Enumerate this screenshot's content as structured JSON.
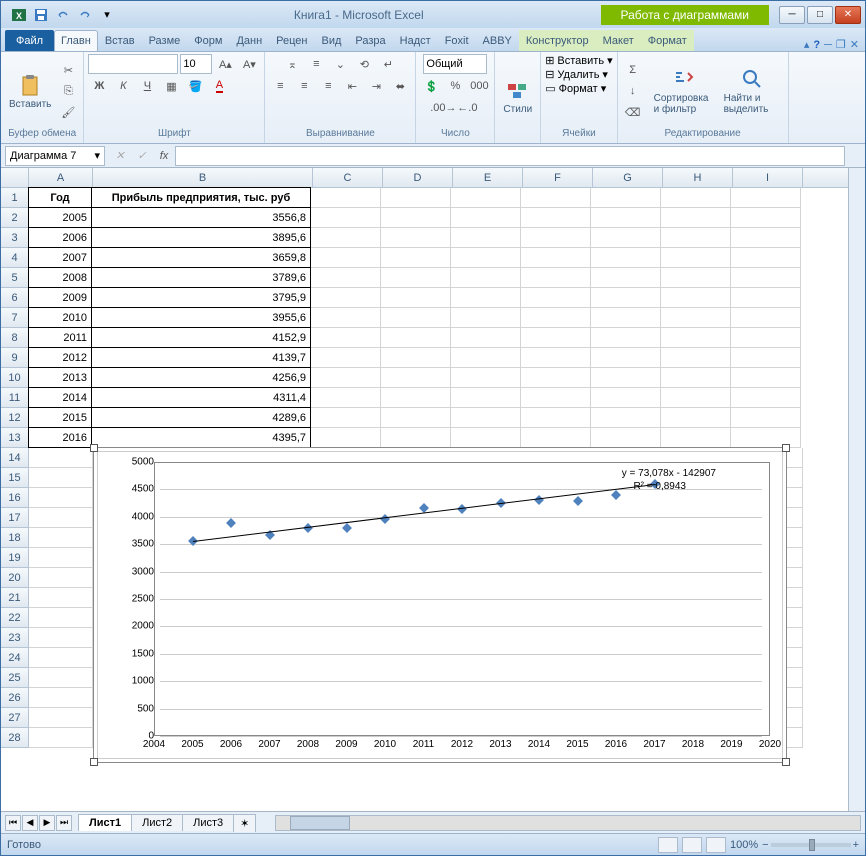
{
  "window": {
    "title": "Книга1 - Microsoft Excel",
    "chart_tools_title": "Работа с диаграммами"
  },
  "ribbon": {
    "file": "Файл",
    "tabs": [
      "Главн",
      "Встав",
      "Разме",
      "Форм",
      "Данн",
      "Рецен",
      "Вид",
      "Разра",
      "Надст",
      "Foxit",
      "ABBY"
    ],
    "chart_tabs": [
      "Конструктор",
      "Макет",
      "Формат"
    ],
    "groups": {
      "clipboard": {
        "paste": "Вставить",
        "label": "Буфер обмена"
      },
      "font": {
        "font_name": "",
        "font_size": "10",
        "label": "Шрифт"
      },
      "align": {
        "label": "Выравнивание"
      },
      "number": {
        "format": "Общий",
        "label": "Число"
      },
      "styles": {
        "btn": "Стили",
        "label": ""
      },
      "cells": {
        "insert": "Вставить",
        "delete": "Удалить",
        "format": "Формат",
        "label": "Ячейки"
      },
      "editing": {
        "sort": "Сортировка и фильтр",
        "find": "Найти и выделить",
        "label": "Редактирование"
      }
    }
  },
  "name_box": "Диаграмма 7",
  "formula": "",
  "columns": [
    "A",
    "B",
    "C",
    "D",
    "E",
    "F",
    "G",
    "H",
    "I"
  ],
  "table": {
    "headers": {
      "A": "Год",
      "B": "Прибыль предприятия, тыс. руб"
    },
    "rows": [
      {
        "r": 2,
        "A": "2005",
        "B": "3556,8"
      },
      {
        "r": 3,
        "A": "2006",
        "B": "3895,6"
      },
      {
        "r": 4,
        "A": "2007",
        "B": "3659,8"
      },
      {
        "r": 5,
        "A": "2008",
        "B": "3789,6"
      },
      {
        "r": 6,
        "A": "2009",
        "B": "3795,9"
      },
      {
        "r": 7,
        "A": "2010",
        "B": "3955,6"
      },
      {
        "r": 8,
        "A": "2011",
        "B": "4152,9"
      },
      {
        "r": 9,
        "A": "2012",
        "B": "4139,7"
      },
      {
        "r": 10,
        "A": "2013",
        "B": "4256,9"
      },
      {
        "r": 11,
        "A": "2014",
        "B": "4311,4"
      },
      {
        "r": 12,
        "A": "2015",
        "B": "4289,6"
      },
      {
        "r": 13,
        "A": "2016",
        "B": "4395,7"
      }
    ]
  },
  "chart_data": {
    "type": "scatter",
    "x": [
      2005,
      2006,
      2007,
      2008,
      2009,
      2010,
      2011,
      2012,
      2013,
      2014,
      2015,
      2016,
      2017
    ],
    "y": [
      3556.8,
      3895.6,
      3659.8,
      3789.6,
      3795.9,
      3955.6,
      4152.9,
      4139.7,
      4256.9,
      4311.4,
      4289.6,
      4395.7,
      4600
    ],
    "trendline": {
      "equation": "y = 73,078x - 142907",
      "r2": "R² = 0,8943"
    },
    "y_ticks": [
      0,
      500,
      1000,
      1500,
      2000,
      2500,
      3000,
      3500,
      4000,
      4500,
      5000
    ],
    "x_ticks": [
      2004,
      2005,
      2006,
      2007,
      2008,
      2009,
      2010,
      2011,
      2012,
      2013,
      2014,
      2015,
      2016,
      2017,
      2018,
      2019,
      2020
    ],
    "xlim": [
      2004,
      2020
    ],
    "ylim": [
      0,
      5000
    ]
  },
  "sheets": {
    "active": "Лист1",
    "tabs": [
      "Лист1",
      "Лист2",
      "Лист3"
    ]
  },
  "status": {
    "ready": "Готово",
    "zoom": "100%"
  }
}
